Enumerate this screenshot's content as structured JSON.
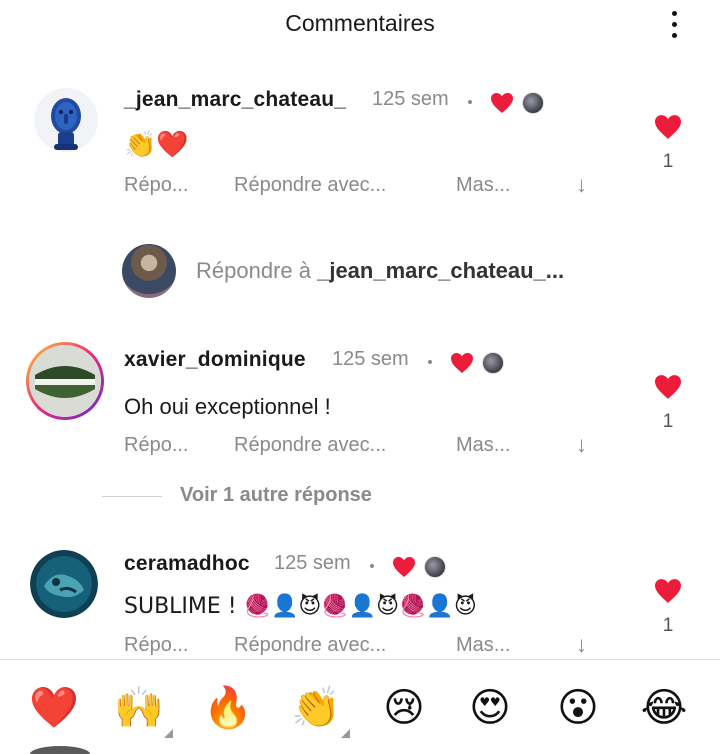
{
  "header": {
    "title": "Commentaires"
  },
  "comments": [
    {
      "username": "_jean_marc_chateau_",
      "time": "125 sem",
      "text": "👏❤️",
      "actions": [
        "Répo...",
        "Répondre avec...",
        "Mas..."
      ],
      "likes": "1",
      "avatar_icon": "blue-sculpture-avatar"
    },
    {
      "username": "xavier_dominique",
      "time": "125 sem",
      "text": "Oh oui exceptionnel !",
      "actions": [
        "Répo...",
        "Répondre avec...",
        "Mas..."
      ],
      "likes": "1",
      "avatar_icon": "green-plate-avatar"
    },
    {
      "username": "ceramadhoc",
      "time": "125 sem",
      "text": "SUBLIME ! 🧶👤😈🧶👤😈🧶👤😈",
      "actions": [
        "Répo...",
        "Répondre avec...",
        "Mas..."
      ],
      "likes": "1",
      "avatar_icon": "teal-ceramic-avatar"
    }
  ],
  "reply": {
    "prefix": "Répondre à ",
    "target": "_jean_marc_chateau_..."
  },
  "view_more": {
    "label": "Voir 1 autre réponse"
  },
  "emoji_bar": [
    "❤️",
    "🙌",
    "🔥",
    "👏",
    "😢",
    "😍",
    "😮",
    "😂"
  ],
  "colors": {
    "like_red": "#ed1c3a",
    "muted_text": "#8a8a8a"
  }
}
